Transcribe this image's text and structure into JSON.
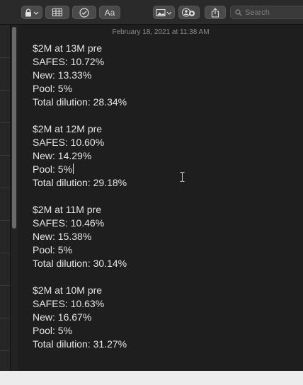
{
  "toolbar": {
    "buttons": [
      {
        "name": "lock-button",
        "icon": "lock-icon"
      },
      {
        "name": "table-button",
        "icon": "table-icon"
      },
      {
        "name": "checklist-button",
        "icon": "checkmark-circle-icon"
      },
      {
        "name": "format-button",
        "label": "Aa"
      },
      {
        "name": "media-button",
        "icon": "photo-icon"
      },
      {
        "name": "collaborate-button",
        "icon": "add-people-icon"
      },
      {
        "name": "share-button",
        "icon": "share-icon"
      }
    ],
    "search_placeholder": "Search"
  },
  "note": {
    "timestamp": "February 18, 2021 at 11:38 AM",
    "blocks": [
      [
        "$2M at 13M pre",
        "SAFES: 10.72%",
        "New: 13.33%",
        "Pool: 5%",
        "Total dilution: 28.34%"
      ],
      [
        "$2M at 12M pre",
        "SAFES: 10.60%",
        "New: 14.29%",
        "Pool: 5%",
        "Total dilution: 29.18%"
      ],
      [
        "$2M at 11M pre",
        "SAFES: 10.46%",
        "New: 15.38%",
        "Pool: 5%",
        "Total dilution: 30.14%"
      ],
      [
        "$2M at 10M pre",
        "SAFES: 10.63%",
        "New: 16.67%",
        "Pool: 5%",
        "Total dilution: 31.27%"
      ]
    ]
  }
}
